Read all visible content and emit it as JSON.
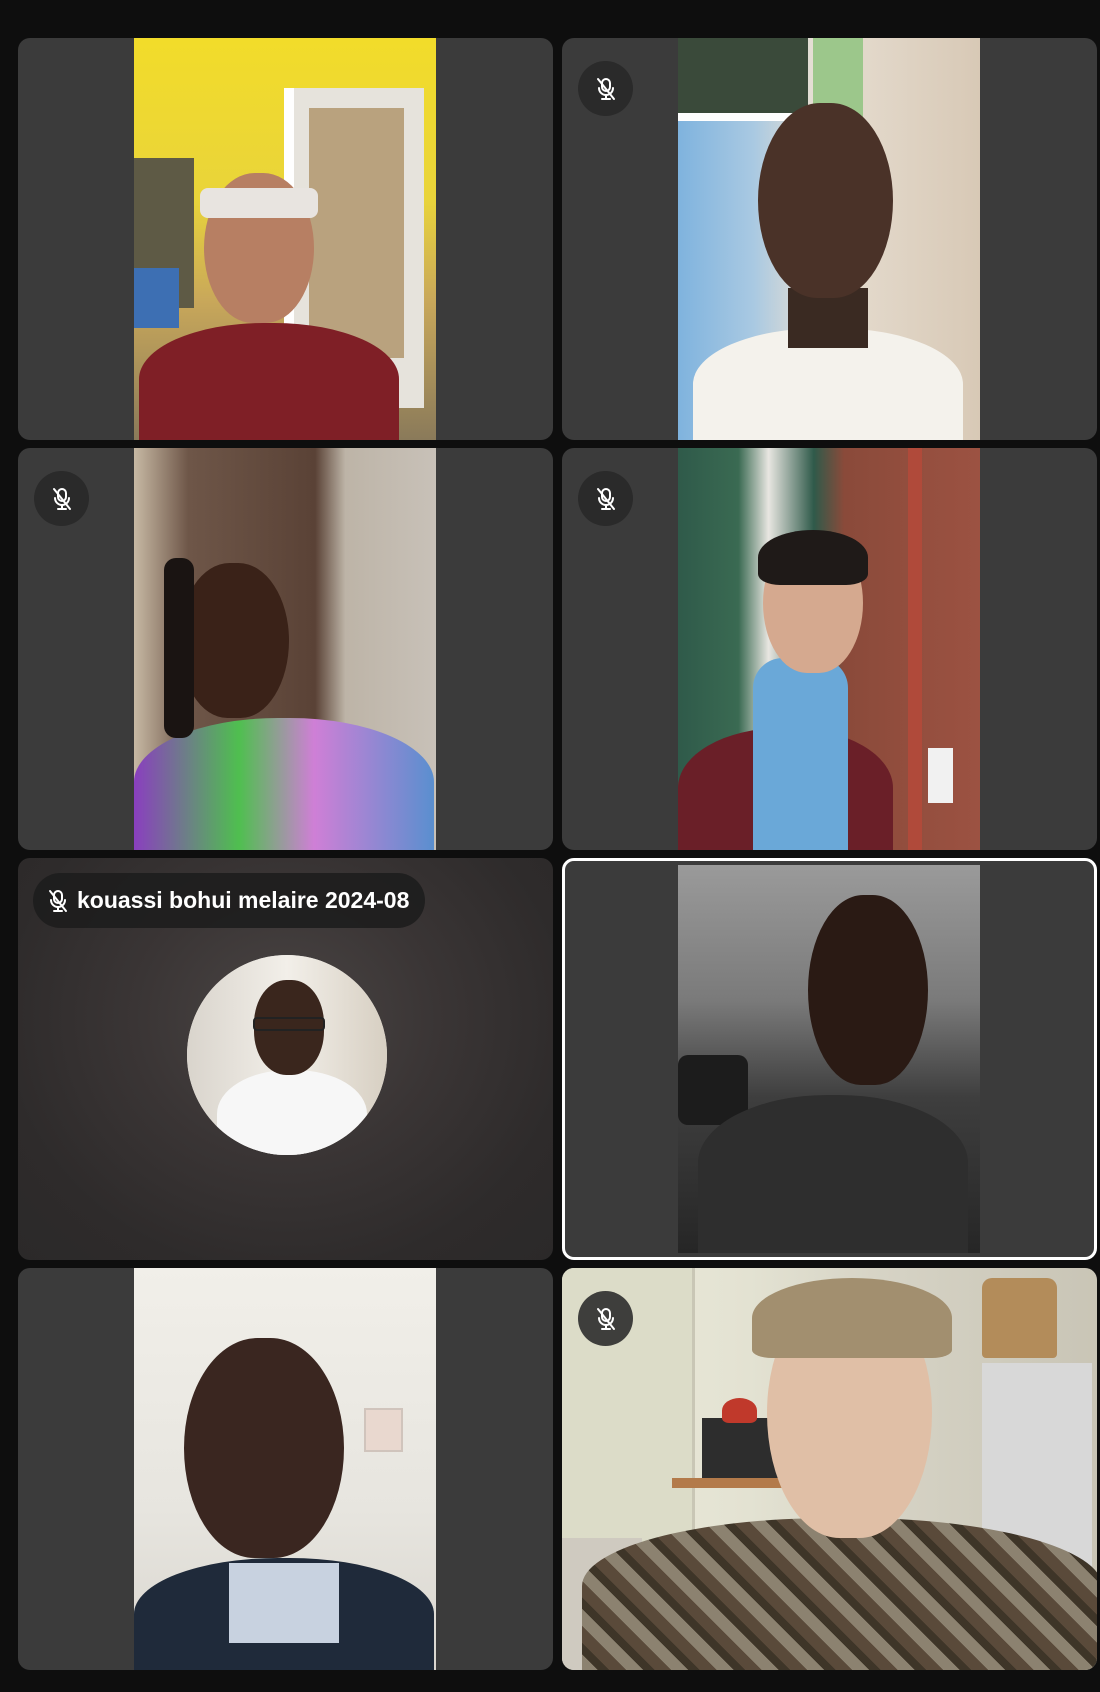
{
  "app": {
    "name": "Video meeting gallery view"
  },
  "participants": [
    {
      "tile": "p1",
      "muted": false,
      "video": true,
      "active_speaker": false
    },
    {
      "tile": "p2",
      "muted": true,
      "video": true,
      "active_speaker": false
    },
    {
      "tile": "p3",
      "muted": true,
      "video": true,
      "active_speaker": false
    },
    {
      "tile": "p4",
      "muted": true,
      "video": true,
      "active_speaker": false
    },
    {
      "tile": "p5",
      "muted": true,
      "video": false,
      "active_speaker": false,
      "name": "kouassi bohui melaire 2024-08"
    },
    {
      "tile": "p6",
      "muted": false,
      "video": true,
      "active_speaker": true
    },
    {
      "tile": "p7",
      "muted": false,
      "video": true,
      "active_speaker": false
    },
    {
      "tile": "p8",
      "muted": true,
      "video": true,
      "active_speaker": false
    }
  ],
  "icons": {
    "mute": "mic-off-icon"
  },
  "colors": {
    "tile_bg": "#3b3b3b",
    "page_bg": "#0e0e0e",
    "active_outline": "#ffffff",
    "pill_bg": "#1c1c1c",
    "text": "#ffffff"
  }
}
